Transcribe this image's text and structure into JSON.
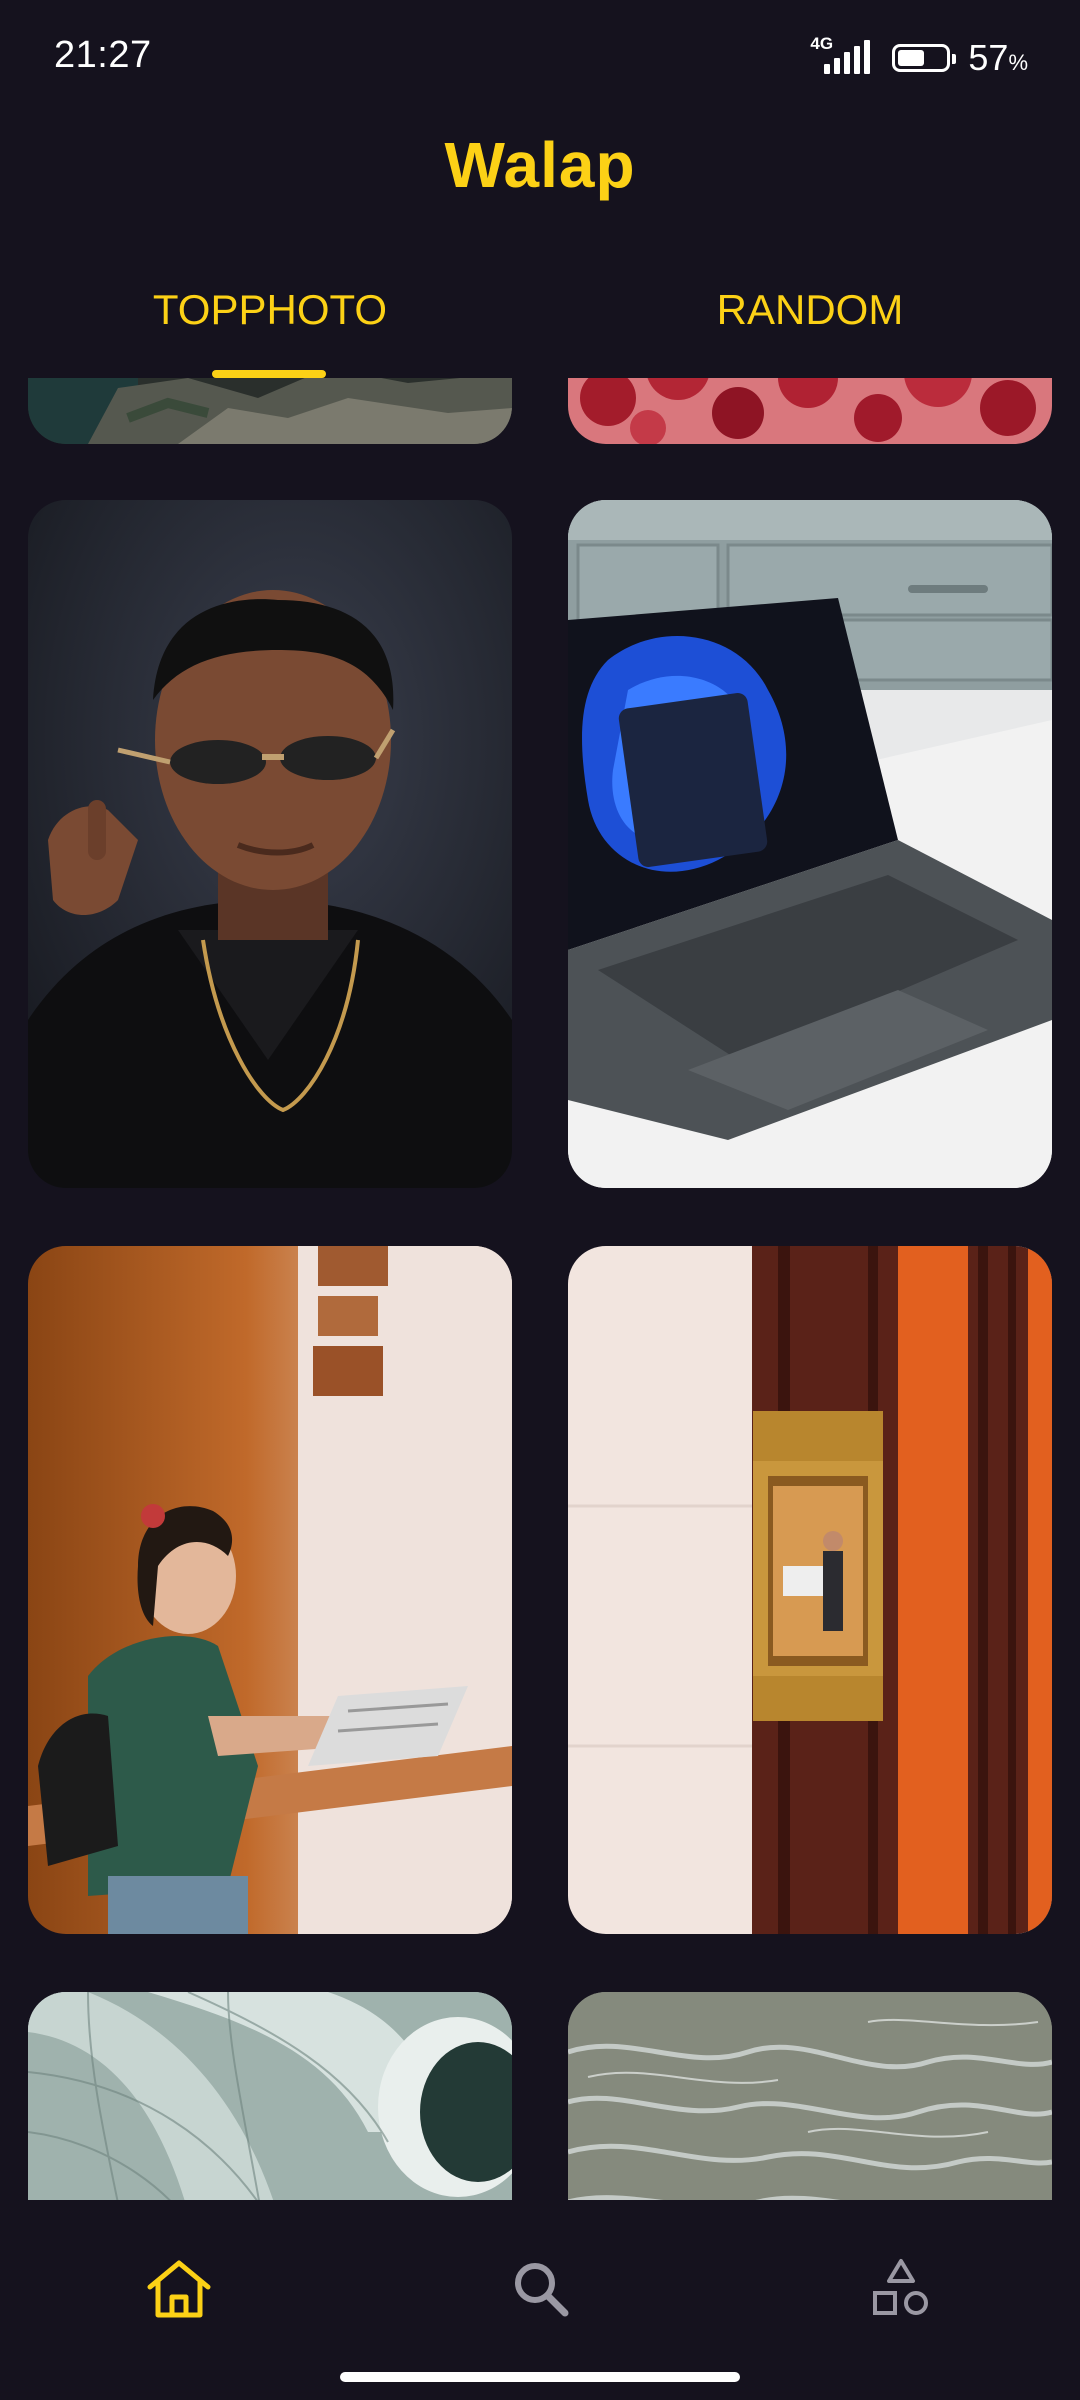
{
  "status_bar": {
    "time": "21:27",
    "network": "4G",
    "battery_percent_value": "57",
    "battery_percent_sign": "%",
    "battery_level": 0.57
  },
  "app": {
    "title": "Walap",
    "accent_color": "#fcd116",
    "background_color": "#15121e"
  },
  "tabs": [
    {
      "label": "TOPPHOTO",
      "selected": true
    },
    {
      "label": "RANDOM",
      "selected": false
    }
  ],
  "photos": [
    {
      "subject": "rocky coastline",
      "column": "left",
      "partial": true
    },
    {
      "subject": "red cells",
      "column": "right",
      "partial": true
    },
    {
      "subject": "man with sunglasses",
      "column": "left"
    },
    {
      "subject": "laptop on table",
      "column": "right"
    },
    {
      "subject": "woman with newspaper",
      "column": "left"
    },
    {
      "subject": "elevator cabin",
      "column": "right"
    },
    {
      "subject": "spiral tunnel",
      "column": "left",
      "partial": true
    },
    {
      "subject": "water surface",
      "column": "right",
      "partial": true
    }
  ],
  "bottom_nav": [
    {
      "icon": "home-icon",
      "selected": true
    },
    {
      "icon": "search-icon",
      "selected": false
    },
    {
      "icon": "categories-icon",
      "selected": false
    }
  ]
}
